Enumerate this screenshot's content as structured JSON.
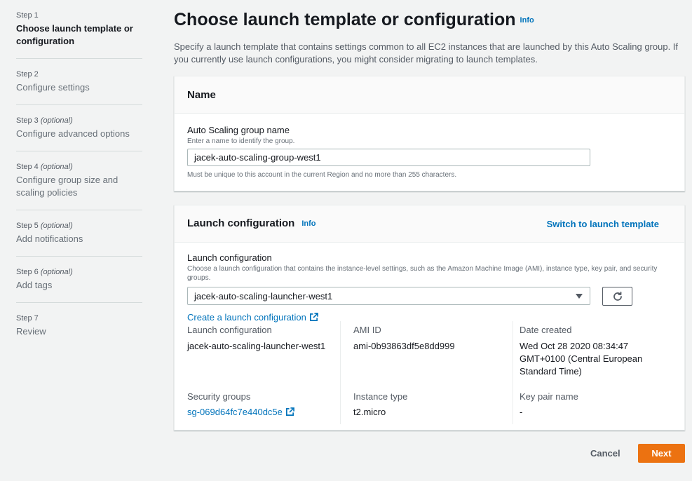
{
  "steps": [
    {
      "num": "Step 1",
      "optional": "",
      "title": "Choose launch template or configuration",
      "active": true
    },
    {
      "num": "Step 2",
      "optional": "",
      "title": "Configure settings",
      "active": false
    },
    {
      "num": "Step 3",
      "optional": "(optional)",
      "title": "Configure advanced options",
      "active": false
    },
    {
      "num": "Step 4",
      "optional": "(optional)",
      "title": "Configure group size and scaling policies",
      "active": false
    },
    {
      "num": "Step 5",
      "optional": "(optional)",
      "title": "Add notifications",
      "active": false
    },
    {
      "num": "Step 6",
      "optional": "(optional)",
      "title": "Add tags",
      "active": false
    },
    {
      "num": "Step 7",
      "optional": "",
      "title": "Review",
      "active": false
    }
  ],
  "page": {
    "title": "Choose launch template or configuration",
    "info": "Info",
    "description": "Specify a launch template that contains settings common to all EC2 instances that are launched by this Auto Scaling group. If you currently use launch configurations, you might consider migrating to launch templates."
  },
  "name_panel": {
    "title": "Name",
    "field_label": "Auto Scaling group name",
    "field_desc": "Enter a name to identify the group.",
    "value": "jacek-auto-scaling-group-west1",
    "constraint": "Must be unique to this account in the current Region and no more than 255 characters."
  },
  "lc_panel": {
    "title": "Launch configuration",
    "info": "Info",
    "switch_link": "Switch to launch template",
    "field_label": "Launch configuration",
    "field_desc": "Choose a launch configuration that contains the instance-level settings, such as the Amazon Machine Image (AMI), instance type, key pair, and security groups.",
    "selected": "jacek-auto-scaling-launcher-west1",
    "create_link": "Create a launch configuration",
    "details": {
      "lc_label": "Launch configuration",
      "lc_value": "jacek-auto-scaling-launcher-west1",
      "ami_label": "AMI ID",
      "ami_value": "ami-0b93863df5e8dd999",
      "date_label": "Date created",
      "date_value_1": "Wed Oct 28 2020 08:34:47",
      "date_value_2": "GMT+0100 (Central European",
      "date_value_3": "Standard Time)",
      "sg_label": "Security groups",
      "sg_value": "sg-069d64fc7e440dc5e",
      "type_label": "Instance type",
      "type_value": "t2.micro",
      "key_label": "Key pair name",
      "key_value": "-"
    }
  },
  "footer": {
    "cancel": "Cancel",
    "next": "Next"
  },
  "colors": {
    "accent": "#0073bb",
    "primary_button": "#ec7211"
  }
}
